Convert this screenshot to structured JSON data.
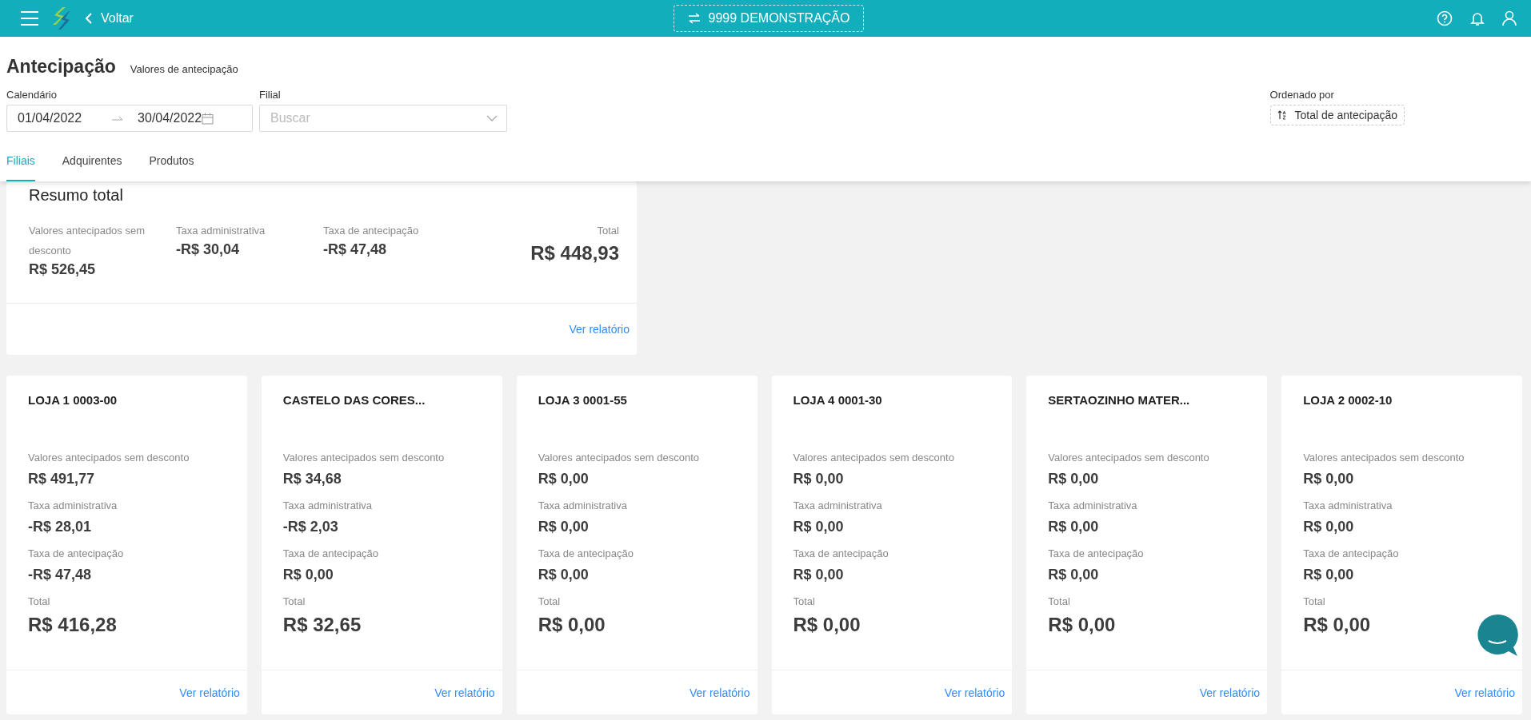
{
  "topbar": {
    "back_label": "Voltar",
    "company": "9999 DEMONSTRAÇÃO"
  },
  "page": {
    "title": "Antecipação",
    "subtitle": "Valores de antecipação"
  },
  "filters": {
    "calendar": {
      "label": "Calendário",
      "start": "01/04/2022",
      "end": "30/04/2022"
    },
    "filial": {
      "label": "Filial",
      "placeholder": "Buscar"
    },
    "sort": {
      "label": "Ordenado por",
      "value": "Total de antecipação"
    }
  },
  "tabs": [
    {
      "label": "Filiais",
      "selected": true
    },
    {
      "label": "Adquirentes",
      "selected": false
    },
    {
      "label": "Produtos",
      "selected": false
    }
  ],
  "summary": {
    "title": "Resumo total",
    "metrics": [
      {
        "label": "Valores antecipados sem desconto",
        "value": "R$ 526,45"
      },
      {
        "label": "Taxa administrativa",
        "value": "-R$ 30,04"
      },
      {
        "label": "Taxa de antecipação",
        "value": "-R$ 47,48"
      }
    ],
    "total": {
      "label": "Total",
      "value": "R$ 448,93"
    },
    "link": "Ver relatório"
  },
  "stores": [
    {
      "name": "LOJA 1 0003-00",
      "metrics": [
        {
          "label": "Valores antecipados sem desconto",
          "value": "R$ 491,77"
        },
        {
          "label": "Taxa administrativa",
          "value": "-R$ 28,01"
        },
        {
          "label": "Taxa de antecipação",
          "value": "-R$ 47,48"
        }
      ],
      "total": {
        "label": "Total",
        "value": "R$ 416,28"
      },
      "link": "Ver relatório"
    },
    {
      "name": "CASTELO DAS CORES...",
      "metrics": [
        {
          "label": "Valores antecipados sem desconto",
          "value": "R$ 34,68"
        },
        {
          "label": "Taxa administrativa",
          "value": "-R$ 2,03"
        },
        {
          "label": "Taxa de antecipação",
          "value": "R$ 0,00"
        }
      ],
      "total": {
        "label": "Total",
        "value": "R$ 32,65"
      },
      "link": "Ver relatório"
    },
    {
      "name": "LOJA 3 0001-55",
      "metrics": [
        {
          "label": "Valores antecipados sem desconto",
          "value": "R$ 0,00"
        },
        {
          "label": "Taxa administrativa",
          "value": "R$ 0,00"
        },
        {
          "label": "Taxa de antecipação",
          "value": "R$ 0,00"
        }
      ],
      "total": {
        "label": "Total",
        "value": "R$ 0,00"
      },
      "link": "Ver relatório"
    },
    {
      "name": "LOJA 4 0001-30",
      "metrics": [
        {
          "label": "Valores antecipados sem desconto",
          "value": "R$ 0,00"
        },
        {
          "label": "Taxa administrativa",
          "value": "R$ 0,00"
        },
        {
          "label": "Taxa de antecipação",
          "value": "R$ 0,00"
        }
      ],
      "total": {
        "label": "Total",
        "value": "R$ 0,00"
      },
      "link": "Ver relatório"
    },
    {
      "name": "SERTAOZINHO MATER...",
      "metrics": [
        {
          "label": "Valores antecipados sem desconto",
          "value": "R$ 0,00"
        },
        {
          "label": "Taxa administrativa",
          "value": "R$ 0,00"
        },
        {
          "label": "Taxa de antecipação",
          "value": "R$ 0,00"
        }
      ],
      "total": {
        "label": "Total",
        "value": "R$ 0,00"
      },
      "link": "Ver relatório"
    },
    {
      "name": "LOJA 2 0002-10",
      "metrics": [
        {
          "label": "Valores antecipados sem desconto",
          "value": "R$ 0,00"
        },
        {
          "label": "Taxa administrativa",
          "value": "R$ 0,00"
        },
        {
          "label": "Taxa de antecipação",
          "value": "R$ 0,00"
        }
      ],
      "total": {
        "label": "Total",
        "value": "R$ 0,00"
      },
      "link": "Ver relatório"
    }
  ]
}
